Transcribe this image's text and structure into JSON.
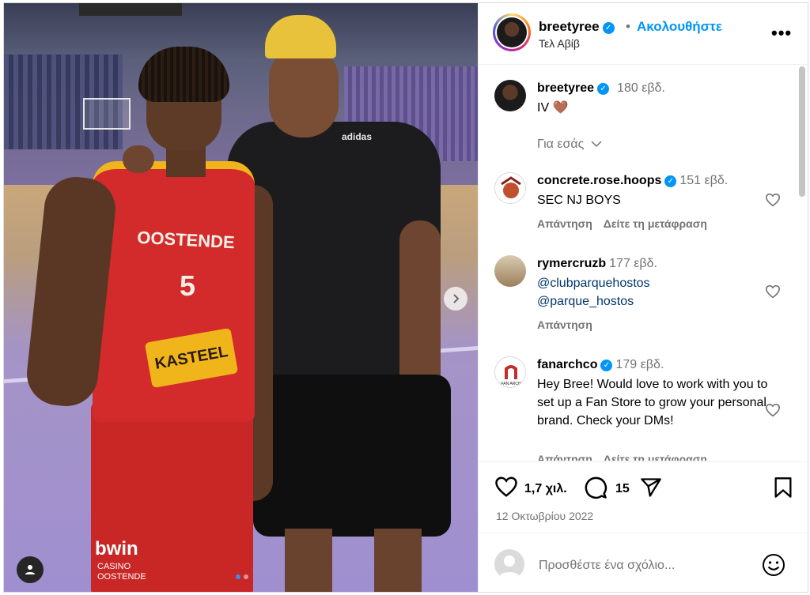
{
  "post": {
    "username": "breetyree",
    "follow_label": "Ακολουθήστε",
    "separator": "•",
    "location": "Τελ Αβίβ",
    "caption": "IV 🤎",
    "caption_time": "180 εβδ.",
    "for_you_label": "Για εσάς",
    "likes": "1,7 χιλ.",
    "comments_count": "15",
    "date": "12 Οκτωβρίου 2022",
    "add_comment_placeholder": "Προσθέστε ένα σχόλιο..."
  },
  "photo": {
    "jersey_text": "OOSTENDE",
    "jersey_number": "5",
    "sponsor_text": "KASTEEL",
    "bwin_text": "bwin",
    "casino_text": "CASINO\nOOSTENDE",
    "shirt_brand": "adidas"
  },
  "comments": [
    {
      "username": "concrete.rose.hoops",
      "verified": true,
      "time": "151 εβδ.",
      "text": "SEC NJ BOYS",
      "reply": "Απάντηση",
      "translate": "Δείτε τη μετάφραση"
    },
    {
      "username": "rymercruzb",
      "verified": false,
      "time": "177 εβδ.",
      "link1": "@clubparquehostos",
      "link2": "@parque_hostos",
      "reply": "Απάντηση"
    },
    {
      "username": "fanarchco",
      "verified": true,
      "time": "179 εβδ.",
      "text": "Hey Bree! Would love to work with you to set up a Fan Store to grow your personal brand. Check your DMs!",
      "reply": "Απάντηση",
      "translate": "Δείτε τη μετάφραση",
      "avatar_text": "FAN ARCH"
    }
  ],
  "colors": {
    "link": "#00376b",
    "follow": "#0095f6",
    "verified": "#0095f6",
    "muted": "#737373"
  }
}
